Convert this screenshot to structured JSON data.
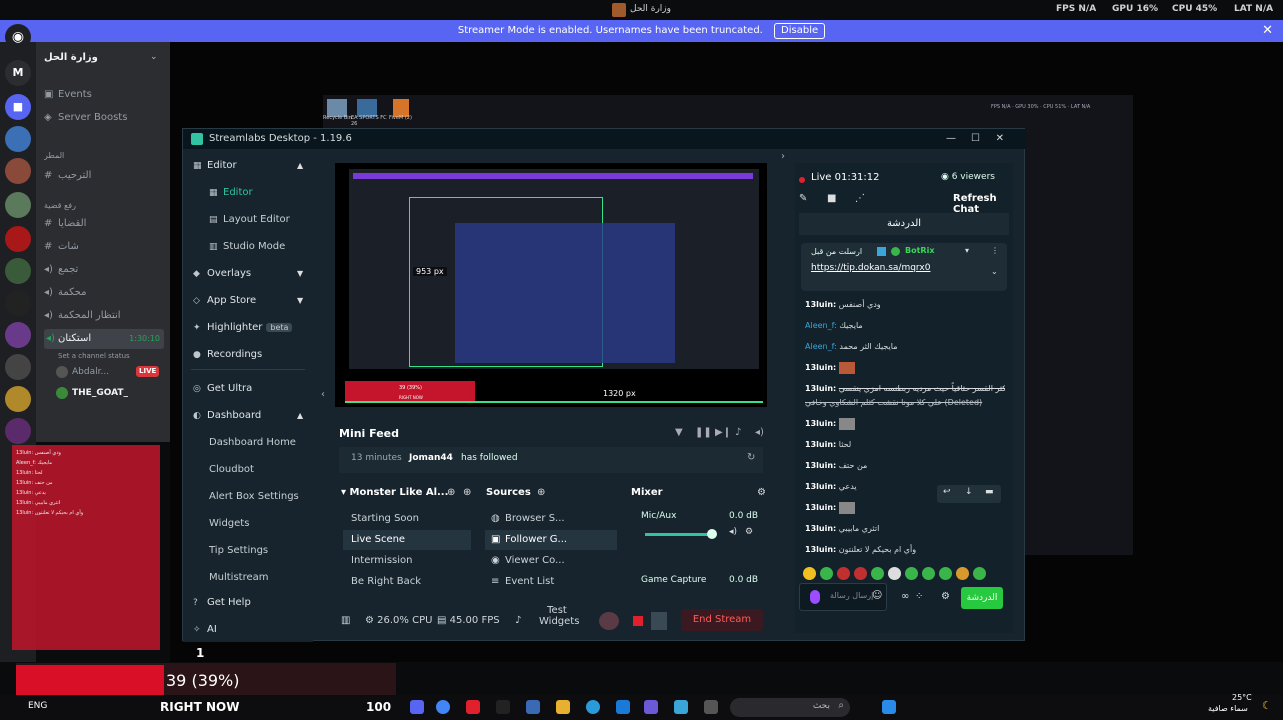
{
  "topbar": {
    "title": "وزارة الحل",
    "fps_label": "FPS",
    "fps_value": "N/A",
    "gpu_label": "GPU",
    "gpu_value": "16%",
    "cpu_label": "CPU",
    "cpu_value": "45%",
    "lat_label": "LAT",
    "lat_value": "N/A"
  },
  "banner": {
    "message": "Streamer Mode is enabled. Usernames have been truncated.",
    "disable": "Disable"
  },
  "discord": {
    "server_name": "وزارة الحل",
    "events": "Events",
    "boosts": "Server Boosts",
    "cat1": "المطر",
    "ch1": "الترحيب",
    "cat2": "رفع قضية",
    "ch2": "القضايا",
    "ch3": "شات",
    "ch4": "تجمع",
    "ch5": "محكمة",
    "ch6": "انتظار المحكمة",
    "voice_channel": "استكنان",
    "voice_time": "1:30:10",
    "channel_status": "Set a channel status",
    "user1": "Abdalr...",
    "live": "LIVE",
    "user2": "THE_GOAT_"
  },
  "desktop": {
    "recycle": "Recycle Bin",
    "eafc": "EA SPORTS FC 26",
    "fivem": "FiveM (2)"
  },
  "streamlabs": {
    "title": "Streamlabs Desktop - 1.19.6",
    "nav": {
      "editor": "Editor",
      "editor_sub": "Editor",
      "layout": "Layout Editor",
      "studio": "Studio Mode",
      "overlays": "Overlays",
      "appstore": "App Store",
      "highlighter": "Highlighter",
      "beta": "beta",
      "recordings": "Recordings",
      "getultra": "Get Ultra",
      "dashboard": "Dashboard",
      "dash_home": "Dashboard Home",
      "cloudbot": "Cloudbot",
      "alertbox": "Alert Box Settings",
      "widgets": "Widgets",
      "tip": "Tip Settings",
      "multistream": "Multistream",
      "help": "Get Help",
      "ai": "AI"
    },
    "preview": {
      "px1": "953 px",
      "px2": "1320 px",
      "progress": "39 (39%)",
      "right_now": "RIGHT NOW"
    },
    "minifeed": {
      "title": "Mini Feed",
      "time": "13 minutes",
      "user": "Joman44",
      "action": "has followed"
    },
    "scenes": {
      "title": "Monster Like Al...",
      "items": [
        "Starting Soon",
        "Live Scene",
        "Intermission",
        "Be Right Back"
      ]
    },
    "sources": {
      "title": "Sources",
      "items": [
        "Browser S...",
        "Follower G...",
        "Viewer Co...",
        "Event List"
      ]
    },
    "mixer": {
      "title": "Mixer",
      "mic": "Mic/Aux",
      "mic_db": "0.0 dB",
      "game": "Game Capture",
      "game_db": "0.0 dB"
    },
    "status": {
      "cpu": "26.0% CPU",
      "fps": "45.00 FPS",
      "test": "Test",
      "widgets": "Widgets",
      "end": "End Stream"
    },
    "chat": {
      "live": "Live 01:31:12",
      "viewers": "6 viewers",
      "refresh": "Refresh Chat",
      "header": "الدردشة",
      "pinned_by": "ارسلت من قبل",
      "botrix": "BotRix",
      "pinned_link": "https://tip.dokan.sa/mqrx0",
      "messages": [
        {
          "user": "13luin:",
          "text": "ودي أصنفس"
        },
        {
          "user": "Aleen_f:",
          "text": "مايجيك"
        },
        {
          "user": "Aleen_f:",
          "text": "مايجيك الثر محمد"
        },
        {
          "user": "13luin:",
          "text": ""
        },
        {
          "user": "13luin:",
          "text": "من كثر القسر حثاقياً حيث مرديه ربطنسه امزي ينقسي"
        },
        {
          "user": "",
          "text": "علي كلا مونا نقشت كثلم الشكاوي وخافي (Deleted)"
        },
        {
          "user": "13luin:",
          "text": ""
        },
        {
          "user": "13luin:",
          "text": "لحثا"
        },
        {
          "user": "13luin:",
          "text": "من حتف"
        },
        {
          "user": "13luin:",
          "text": "يدعي"
        },
        {
          "user": "13luin:",
          "text": ""
        },
        {
          "user": "13luin:",
          "text": "اتثري مابيبي"
        },
        {
          "user": "13luin:",
          "text": "وأي ام بحيكم لا تعلنتون"
        }
      ],
      "input_placeholder": "إرسال رسالة",
      "send": "الدردشة"
    }
  },
  "overlay": {
    "count": "1",
    "progress_text": "39 (39%)",
    "right_now": "RIGHT NOW",
    "num100": "100"
  },
  "taskbar": {
    "eng": "ENG",
    "search": "بحث",
    "temp": "25°C",
    "weather": "سماء صافية"
  }
}
